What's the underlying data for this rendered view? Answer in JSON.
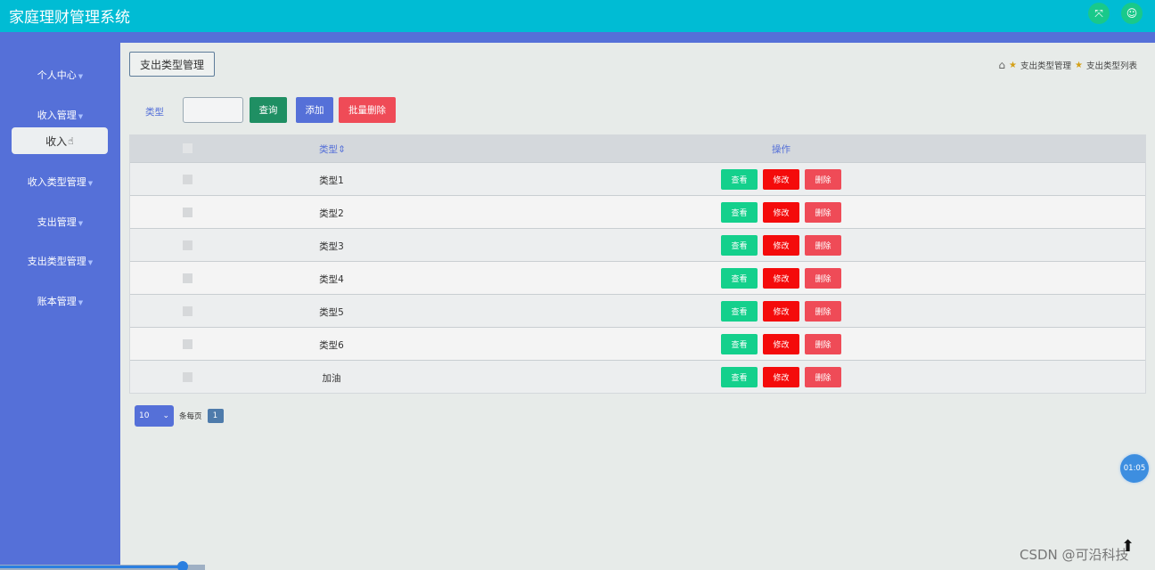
{
  "app": {
    "title": "家庭理财管理系统"
  },
  "header_icons": {
    "expand": "expand-icon",
    "user": "user-icon"
  },
  "sidebar": {
    "items": [
      {
        "label": "个人中心"
      },
      {
        "label": "收入管理"
      },
      {
        "label": "收入类型管理"
      },
      {
        "label": "支出管理"
      },
      {
        "label": "支出类型管理"
      },
      {
        "label": "账本管理"
      }
    ],
    "sub_item": "收入"
  },
  "page": {
    "tab": "支出类型管理"
  },
  "breadcrumb": {
    "item1": "支出类型管理",
    "item2": "支出类型列表"
  },
  "search": {
    "label": "类型",
    "value": "",
    "query_btn": "查询",
    "add_btn": "添加",
    "bulk_delete_btn": "批量删除"
  },
  "table": {
    "headers": {
      "type": "类型",
      "sort": "⇕",
      "ops": "操作"
    },
    "rows": [
      {
        "type": "类型1"
      },
      {
        "type": "类型2"
      },
      {
        "type": "类型3"
      },
      {
        "type": "类型4"
      },
      {
        "type": "类型5"
      },
      {
        "type": "类型6"
      },
      {
        "type": "加油"
      }
    ],
    "actions": {
      "view": "查看",
      "edit": "修改",
      "delete": "删除"
    }
  },
  "pagination": {
    "page_size": "10",
    "per_page_label": "条每页",
    "current_page": "1"
  },
  "overlay": {
    "timer": "01:05",
    "watermark": "CSDN @可沿科技"
  },
  "video": {
    "progress_fraction": 0.89
  },
  "colors": {
    "topbar": "#00bcd4",
    "sidebar": "#5570d8",
    "view": "#14d08c",
    "edit": "#f40b0b",
    "delete": "#ef4b57"
  }
}
